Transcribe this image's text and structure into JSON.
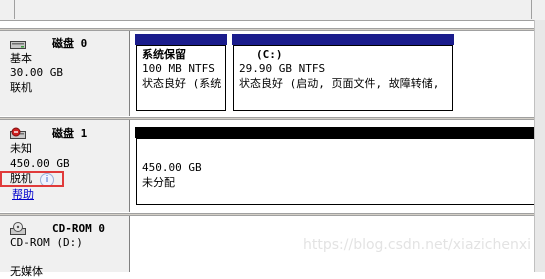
{
  "disks": [
    {
      "name": "磁盘 0",
      "type": "基本",
      "size": "30.00 GB",
      "status": "联机",
      "partitions": [
        {
          "title": "系统保留",
          "fs": "100 MB NTFS",
          "status": "状态良好 (系统"
        },
        {
          "title": "(C:)",
          "fs": "29.90 GB NTFS",
          "status": "状态良好 (启动, 页面文件, 故障转储,"
        }
      ]
    },
    {
      "name": "磁盘 1",
      "type": "未知",
      "size": "450.00 GB",
      "status": "脱机",
      "help_link": "帮助",
      "unallocated": {
        "size": "450.00 GB",
        "label": "未分配"
      }
    },
    {
      "name": "CD-ROM 0",
      "type": "CD-ROM (D:)",
      "media": "无媒体"
    }
  ],
  "watermark": "https://blog.csdn.net/xiazichenxi",
  "colors": {
    "primary_partition_stripe": "#1a1c8c",
    "unallocated_stripe": "#000000",
    "highlight_border": "#e03a3a",
    "info_panel_bg": "#f0f0f0"
  }
}
